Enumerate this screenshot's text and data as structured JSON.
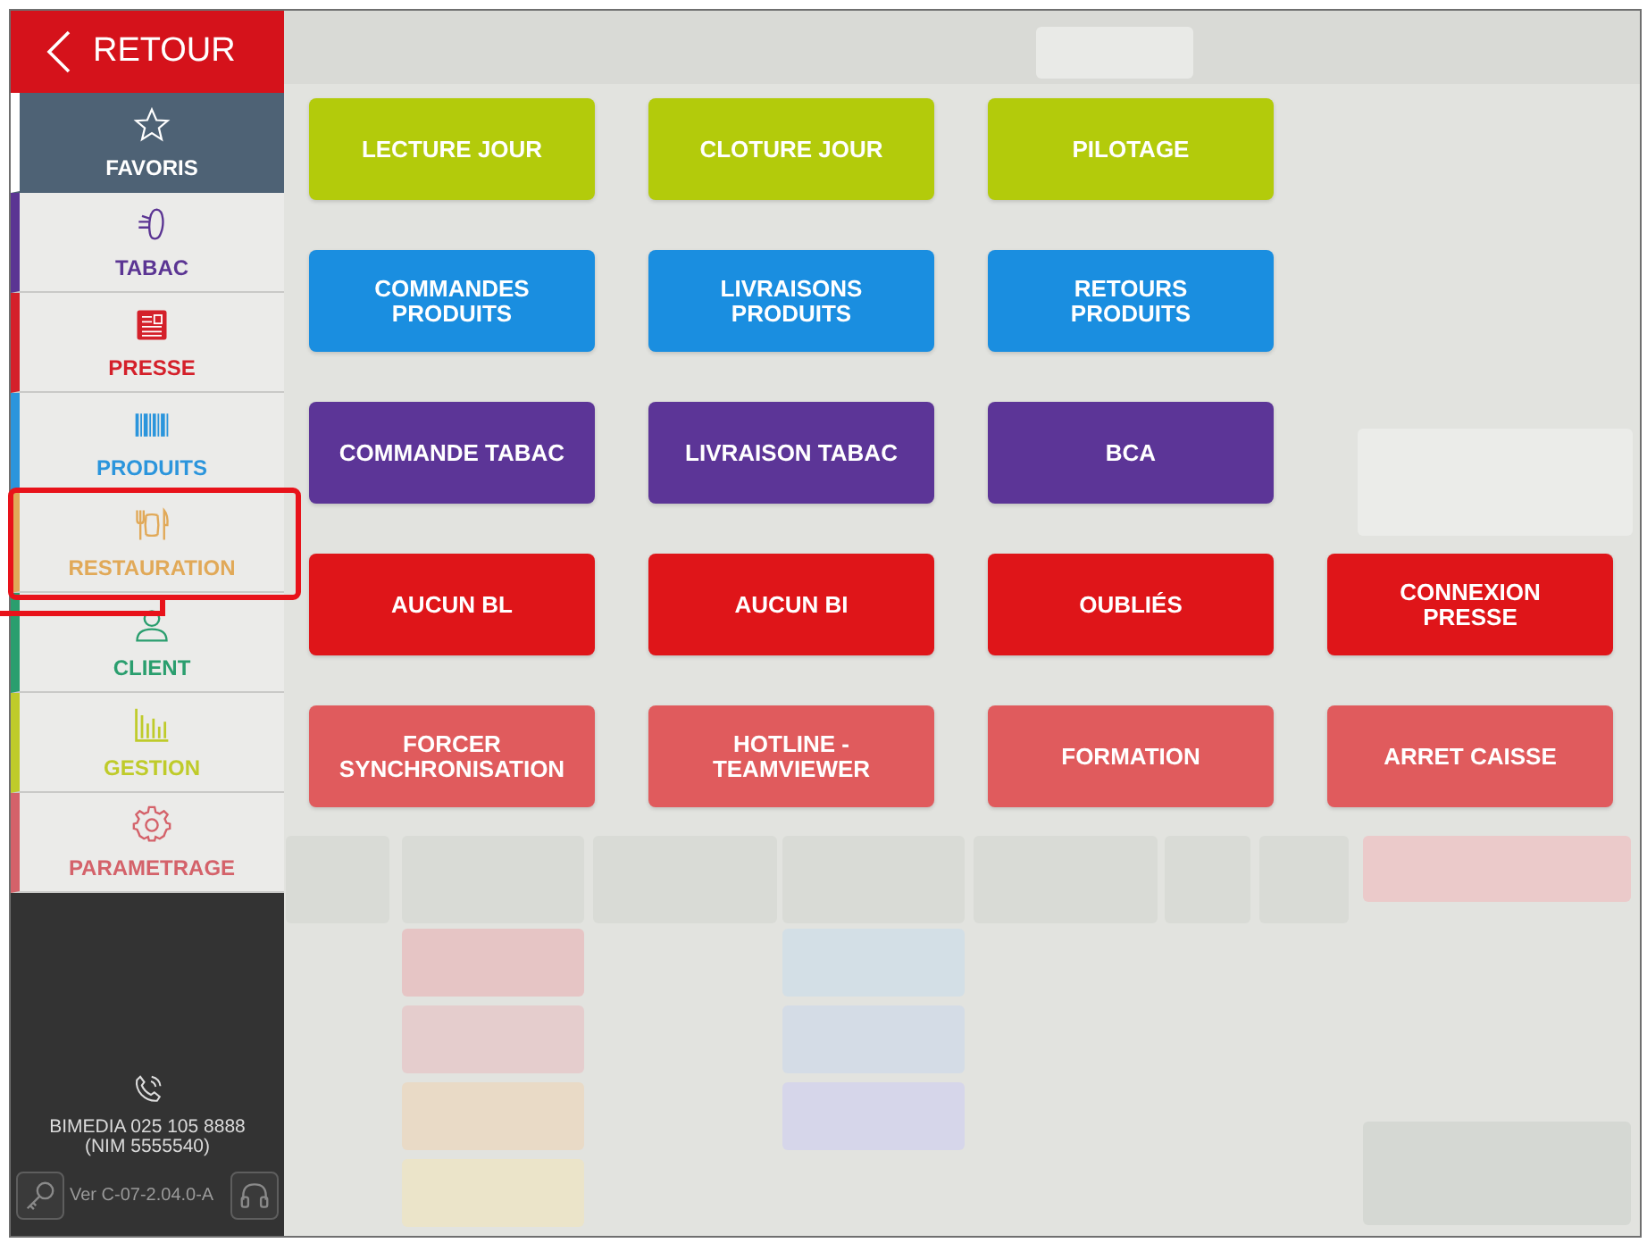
{
  "sidebar": {
    "back_button": {
      "label": "RETOUR"
    },
    "items": [
      {
        "label": "FAVORIS",
        "color": "#ffffff",
        "selected": true,
        "highlighted": false
      },
      {
        "label": "TABAC",
        "color": "#5b3593",
        "selected": false,
        "highlighted": false
      },
      {
        "label": "PRESSE",
        "color": "#d4202a",
        "selected": false,
        "highlighted": false
      },
      {
        "label": "PRODUITS",
        "color": "#2b95dc",
        "selected": false,
        "highlighted": false
      },
      {
        "label": "RESTAURATION",
        "color": "#e1a958",
        "selected": false,
        "highlighted": true
      },
      {
        "label": "CLIENT",
        "color": "#2a9e6e",
        "selected": false,
        "highlighted": false
      },
      {
        "label": "GESTION",
        "color": "#bfcb2a",
        "selected": false,
        "highlighted": false
      },
      {
        "label": "PARAMETRAGE",
        "color": "#d4626a",
        "selected": false,
        "highlighted": false
      }
    ],
    "support": {
      "phone": "BIMEDIA 025 105 8888",
      "id": "(NIM 5555540)"
    },
    "version": "Ver C-07-2.04.0-A"
  },
  "actions": [
    {
      "color": "#b3cb0b",
      "buttons": [
        "LECTURE JOUR",
        "CLOTURE JOUR",
        "PILOTAGE"
      ]
    },
    {
      "color": "#1a8ee0",
      "buttons": [
        "COMMANDES PRODUITS",
        "LIVRAISONS PRODUITS",
        "RETOURS PRODUITS"
      ]
    },
    {
      "color": "#5c3597",
      "buttons": [
        "COMMANDE TABAC",
        "LIVRAISON TABAC",
        "BCA"
      ]
    },
    {
      "color": "#df1519",
      "buttons": [
        "AUCUN BL",
        "AUCUN BI",
        "OUBLIÉS",
        "CONNEXION PRESSE"
      ]
    },
    {
      "color": "#e05b5d",
      "buttons": [
        "FORCER SYNCHRONISATION",
        "HOTLINE - TEAMVIEWER",
        "FORMATION",
        "ARRET CAISSE"
      ]
    }
  ]
}
